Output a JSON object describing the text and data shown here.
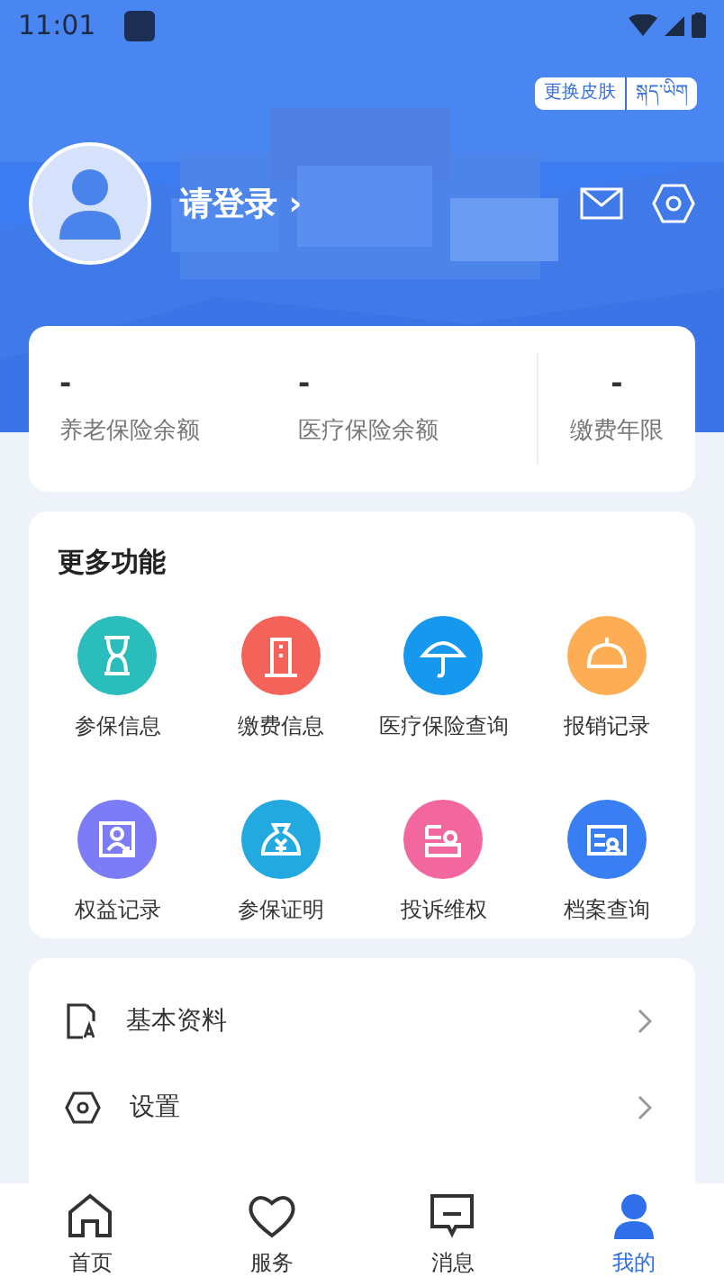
{
  "status_bar": {
    "time": "11:01"
  },
  "header": {
    "skin_button": "更换皮肤",
    "language_button": "སྐད་ཡིག",
    "login": "请登录",
    "login_arrow": "›"
  },
  "stats": [
    {
      "value": "-",
      "label": "养老保险余额"
    },
    {
      "value": "-",
      "label": "医疗保险余额"
    },
    {
      "value": "-",
      "label": "缴费年限"
    }
  ],
  "features": {
    "title": "更多功能",
    "items": [
      {
        "label": "参保信息",
        "color": "#2bbdbb"
      },
      {
        "label": "缴费信息",
        "color": "#f4635a"
      },
      {
        "label": "医疗保险查询",
        "color": "#1598ee"
      },
      {
        "label": "报销记录",
        "color": "#fdae55"
      },
      {
        "label": "权益记录",
        "color": "#7b7cf6"
      },
      {
        "label": "参保证明",
        "color": "#21a9e0"
      },
      {
        "label": "投诉维权",
        "color": "#f2679e"
      },
      {
        "label": "档案查询",
        "color": "#3a7ef3"
      }
    ]
  },
  "menu": [
    {
      "label": "基本资料",
      "kind": "profile"
    },
    {
      "label": "设置",
      "kind": "settings"
    }
  ],
  "tab_bar": [
    {
      "label": "首页",
      "selected": false,
      "kind": "home"
    },
    {
      "label": "服务",
      "selected": false,
      "kind": "heart"
    },
    {
      "label": "消息",
      "selected": false,
      "kind": "message"
    },
    {
      "label": "我的",
      "selected": true,
      "kind": "person"
    }
  ]
}
